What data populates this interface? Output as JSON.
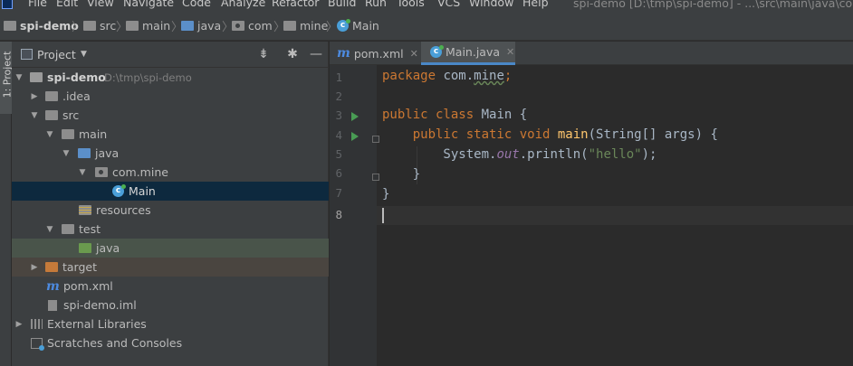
{
  "menu": {
    "items": [
      "File",
      "Edit",
      "View",
      "Navigate",
      "Code",
      "Analyze",
      "Refactor",
      "Build",
      "Run",
      "Tools",
      "VCS",
      "Window",
      "Help"
    ],
    "title": "spi-demo [D:\\tmp\\spi-demo] - ...\\src\\main\\java\\com\\"
  },
  "breadcrumbs": [
    "spi-demo",
    "src",
    "main",
    "java",
    "com",
    "mine",
    "Main"
  ],
  "side_tab": "1: Project",
  "project_panel": {
    "title": "Project",
    "tree": [
      {
        "label": "spi-demo",
        "path": "D:\\tmp\\spi-demo",
        "level": 0,
        "arrow": "▼",
        "icon": "folder-icon"
      },
      {
        "label": ".idea",
        "level": 1,
        "arrow": "▶",
        "icon": "folder-icon"
      },
      {
        "label": "src",
        "level": 1,
        "arrow": "▼",
        "icon": "folder-icon"
      },
      {
        "label": "main",
        "level": 2,
        "arrow": "▼",
        "icon": "folder-icon"
      },
      {
        "label": "java",
        "level": 3,
        "arrow": "▼",
        "icon": "source-folder-icon"
      },
      {
        "label": "com.mine",
        "level": 4,
        "arrow": "▼",
        "icon": "package-icon"
      },
      {
        "label": "Main",
        "level": 5,
        "arrow": "",
        "icon": "java-class-icon"
      },
      {
        "label": "resources",
        "level": 3,
        "arrow": "",
        "icon": "resources-folder-icon"
      },
      {
        "label": "test",
        "level": 2,
        "arrow": "▼",
        "icon": "folder-icon"
      },
      {
        "label": "java",
        "level": 3,
        "arrow": "",
        "icon": "test-folder-icon"
      },
      {
        "label": "target",
        "level": 1,
        "arrow": "▶",
        "icon": "excluded-folder-icon"
      },
      {
        "label": "pom.xml",
        "level": 1,
        "arrow": "",
        "icon": "maven-icon"
      },
      {
        "label": "spi-demo.iml",
        "level": 1,
        "arrow": "",
        "icon": "iml-file-icon"
      },
      {
        "label": "External Libraries",
        "level": 0,
        "arrow": "▶",
        "icon": "libraries-icon"
      },
      {
        "label": "Scratches and Consoles",
        "level": 0,
        "arrow": "",
        "icon": "scratches-icon"
      }
    ]
  },
  "tabs": [
    {
      "label": "pom.xml",
      "icon": "maven-icon",
      "active": false
    },
    {
      "label": "Main.java",
      "icon": "java-class-icon",
      "active": true
    }
  ],
  "editor": {
    "line_numbers": [
      "1",
      "2",
      "3",
      "4",
      "5",
      "6",
      "7",
      "8"
    ],
    "code": {
      "l1_kw": "package",
      "l1_pkg": " com.",
      "l1_pkg_und": "mine",
      "l1_semi": ";",
      "l3_kw": "public class",
      "l3_name": " Main {",
      "l4_kw": "    public static void",
      "l4_fn": " main",
      "l4_rest": "(String[] args) {",
      "l5_a": "        System.",
      "l5_field": "out",
      "l5_b": ".println(",
      "l5_str": "\"hello\"",
      "l5_c": ");",
      "l6": "    }",
      "l7": "}"
    }
  },
  "colors": {
    "keyword": "#cc7832",
    "function": "#ffc66d",
    "string": "#6a8759",
    "field": "#9876aa",
    "text": "#a9b7c6",
    "selection": "#0d293e"
  }
}
